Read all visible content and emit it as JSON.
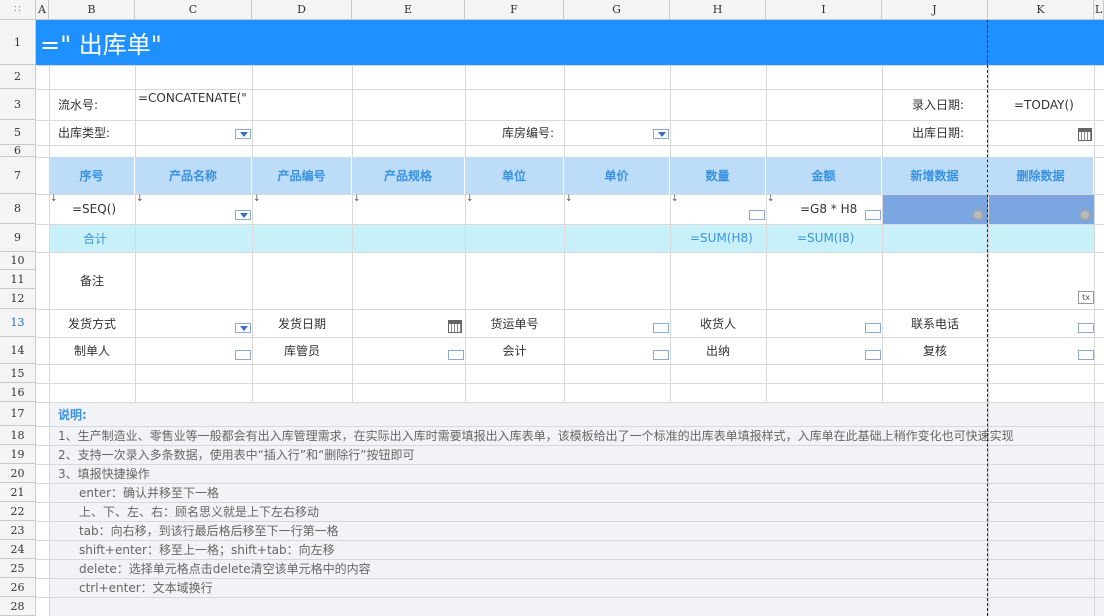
{
  "columns": [
    "A",
    "B",
    "C",
    "D",
    "E",
    "F",
    "G",
    "H",
    "I",
    "J",
    "K",
    "L"
  ],
  "rows": [
    "1",
    "2",
    "3",
    "5",
    "6",
    "7",
    "8",
    "9",
    "10",
    "11",
    "12",
    "13",
    "14",
    "15",
    "16",
    "17",
    "18",
    "19",
    "20",
    "21",
    "22",
    "23",
    "24",
    "25",
    "26",
    "28"
  ],
  "title": "=\"  出库单\"",
  "info": {
    "serial_label": "流水号:",
    "serial_formula": "=CONCATENATE(\"",
    "entry_date_label": "录入日期:",
    "entry_date_formula": "=TODAY()",
    "out_type_label": "出库类型:",
    "warehouse_label": "库房编号:",
    "out_date_label": "出库日期:"
  },
  "table": {
    "headers": [
      "序号",
      "产品名称",
      "产品编号",
      "产品规格",
      "单位",
      "单价",
      "数量",
      "金额",
      "新增数据",
      "删除数据"
    ],
    "row": {
      "seq": "=SEQ()",
      "amount": "=G8 * H8"
    },
    "total_label": "合计",
    "sum_qty": "=SUM(H8)",
    "sum_amount": "=SUM(I8)"
  },
  "remarks_label": "备注",
  "footer_fields": {
    "ship_method": "发货方式",
    "ship_date": "发货日期",
    "waybill": "货运单号",
    "consignee": "收货人",
    "phone": "联系电话",
    "maker": "制单人",
    "keeper": "库管员",
    "accountant": "会计",
    "cashier": "出纳",
    "reviewer": "复核"
  },
  "notes": {
    "title": "说明:",
    "lines": [
      "1、生产制造业、零售业等一般都会有出入库管理需求，在实际出入库时需要填报出入库表单，该模板给出了一个标准的出库表单填报样式，入库单在此基础上稍作变化也可快速实现",
      "2、支持一次录入多条数据，使用表中“插入行”和“删除行”按钮即可",
      "3、填报快捷操作",
      "enter：确认并移至下一格",
      "上、下、左、右：顾名思义就是上下左右移动",
      "tab：向右移，到该行最后格后移至下一行第一格",
      "shift+enter：移至上一格；shift+tab：向左移",
      "delete：选择单元格点击delete清空该单元格中的内容",
      "ctrl+enter：文本域换行"
    ]
  },
  "colors": {
    "title_bg": "#1e90ff",
    "header_bg": "#bddcf7",
    "total_bg": "#c8f0f8",
    "accent": "#3a93e0"
  }
}
